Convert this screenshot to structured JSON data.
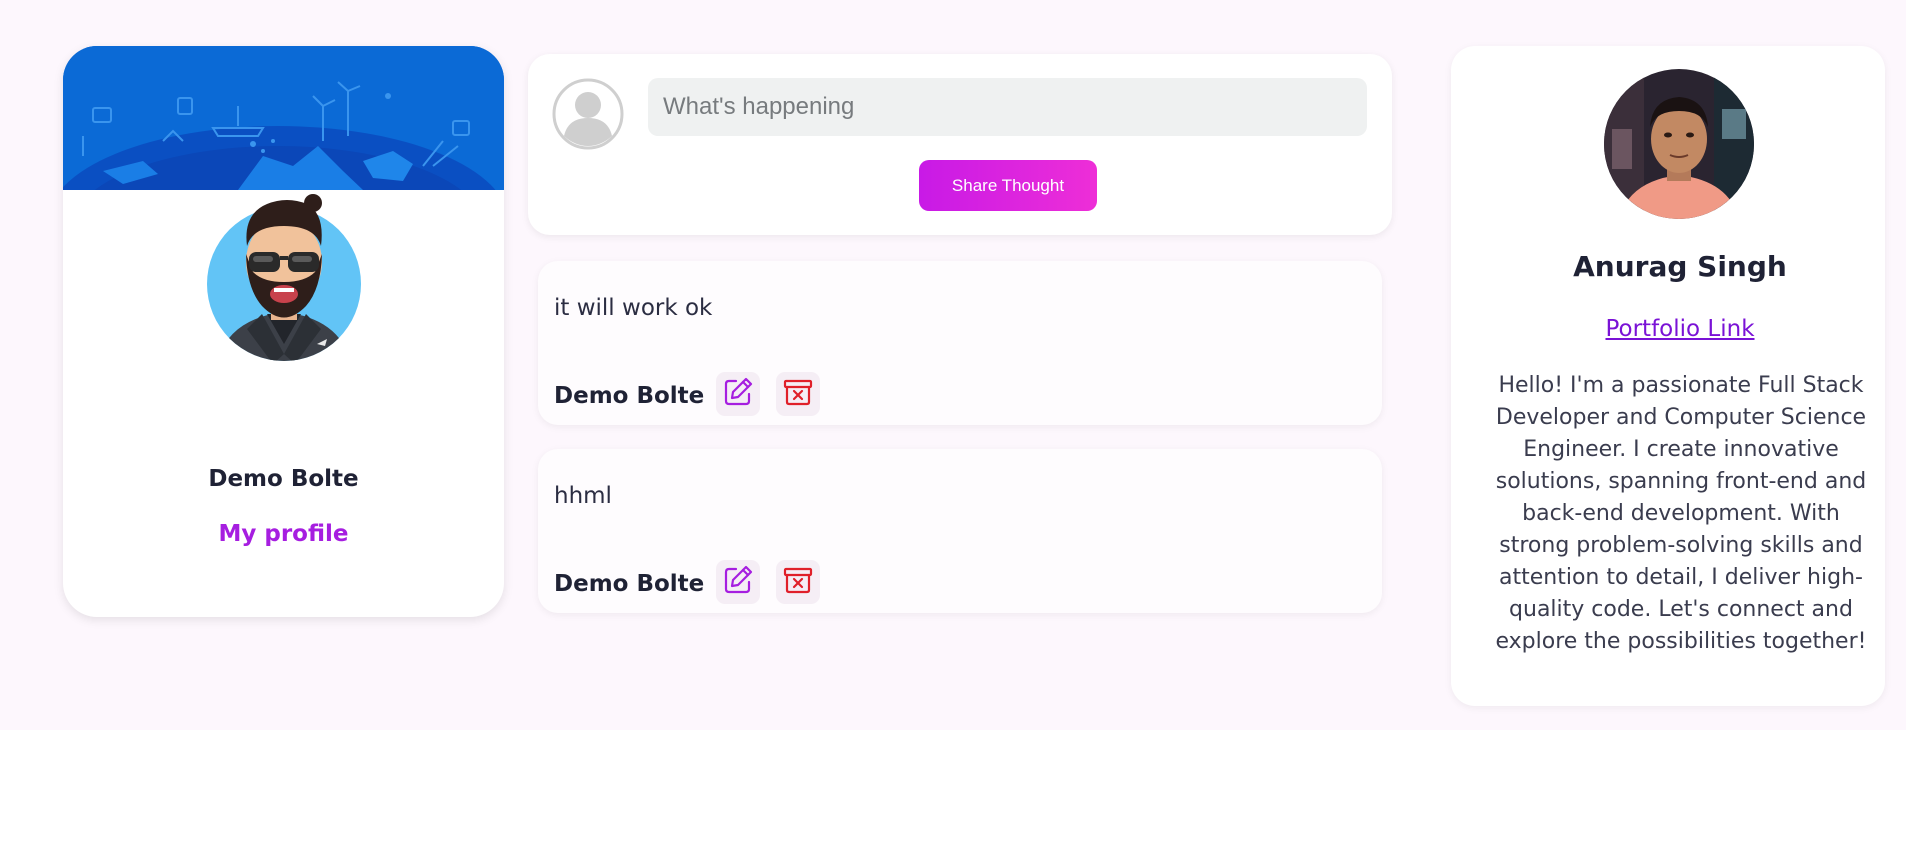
{
  "profile": {
    "name": "Demo Bolte",
    "link_label": "My profile"
  },
  "composer": {
    "placeholder": "What's happening",
    "share_label": "Share Thought"
  },
  "posts": [
    {
      "text": "it will work ok",
      "author": "Demo Bolte"
    },
    {
      "text": "hhml",
      "author": "Demo Bolte"
    }
  ],
  "about": {
    "name": "Anurag Singh",
    "link_label": "Portfolio Link",
    "bio": "Hello! I'm a passionate Full Stack Developer and Computer Science Engineer. I create innovative solutions, spanning front-end and back-end development. With strong problem-solving skills and attention to detail, I deliver high-quality code. Let's connect and explore the possibilities together!"
  },
  "icons": {
    "edit": "edit-icon",
    "delete": "archive-delete-icon",
    "default_avatar": "default-user-icon"
  },
  "colors": {
    "accent_purple": "#a61ee0",
    "share_gradient_start": "#c81ae6",
    "share_gradient_end": "#ee2ed7",
    "delete_red": "#e0202a",
    "banner_blue": "#0a6fd6",
    "page_bg": "#fdf7fd"
  }
}
